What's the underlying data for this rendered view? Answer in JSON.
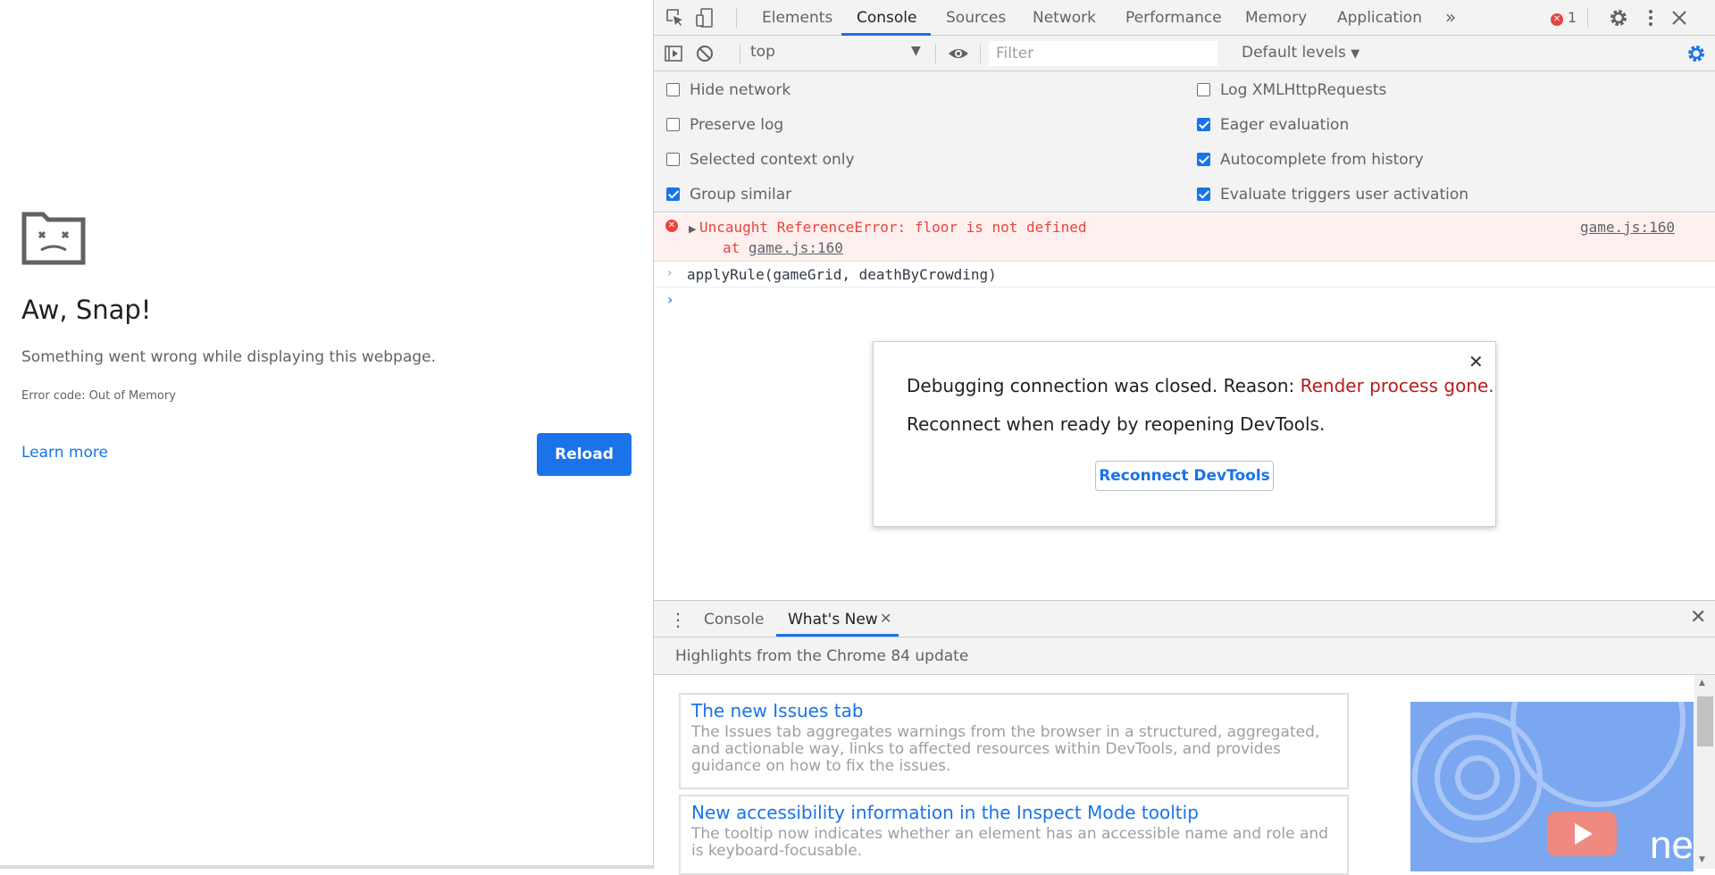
{
  "crash_page": {
    "title": "Aw, Snap!",
    "message": "Something went wrong while displaying this webpage.",
    "error_code": "Error code: Out of Memory",
    "learn_more": "Learn more",
    "reload": "Reload"
  },
  "devtools": {
    "tabs": [
      "Elements",
      "Console",
      "Sources",
      "Network",
      "Performance",
      "Memory",
      "Application"
    ],
    "active_tab": "Console",
    "error_count": "1",
    "console_toolbar": {
      "context": "top",
      "filter_placeholder": "Filter",
      "levels": "Default levels"
    },
    "settings": {
      "left": [
        {
          "label": "Hide network",
          "checked": false
        },
        {
          "label": "Preserve log",
          "checked": false
        },
        {
          "label": "Selected context only",
          "checked": false
        },
        {
          "label": "Group similar",
          "checked": true
        }
      ],
      "right": [
        {
          "label": "Log XMLHttpRequests",
          "checked": false
        },
        {
          "label": "Eager evaluation",
          "checked": true
        },
        {
          "label": "Autocomplete from history",
          "checked": true
        },
        {
          "label": "Evaluate triggers user activation",
          "checked": true
        }
      ]
    },
    "console": {
      "error_message": "Uncaught ReferenceError: floor is not defined",
      "error_at_prefix": "at ",
      "error_at_link": "game.js:160",
      "error_source": "game.js:160",
      "command": "applyRule(gameGrid, deathByCrowding)"
    },
    "dialog": {
      "line1_prefix": "Debugging connection was closed. Reason: ",
      "reason": "Render process gone.",
      "line2": "Reconnect when ready by reopening DevTools.",
      "button": "Reconnect DevTools"
    },
    "drawer": {
      "tab_console": "Console",
      "tab_whats_new": "What's New",
      "highlights": "Highlights from the Chrome 84 update",
      "cards": [
        {
          "title": "The new Issues tab",
          "description": "The Issues tab aggregates warnings from the browser in a structured, aggregated, and actionable way, links to affected resources within DevTools, and provides guidance on how to fix the issues."
        },
        {
          "title": "New accessibility information in the Inspect Mode tooltip",
          "description": "The tooltip now indicates whether an element has an accessible name and role and is keyboard-focusable."
        }
      ]
    },
    "colors": {
      "accent": "#1a73e8",
      "error": "#e8453c",
      "reason": "#b71c1c"
    }
  }
}
